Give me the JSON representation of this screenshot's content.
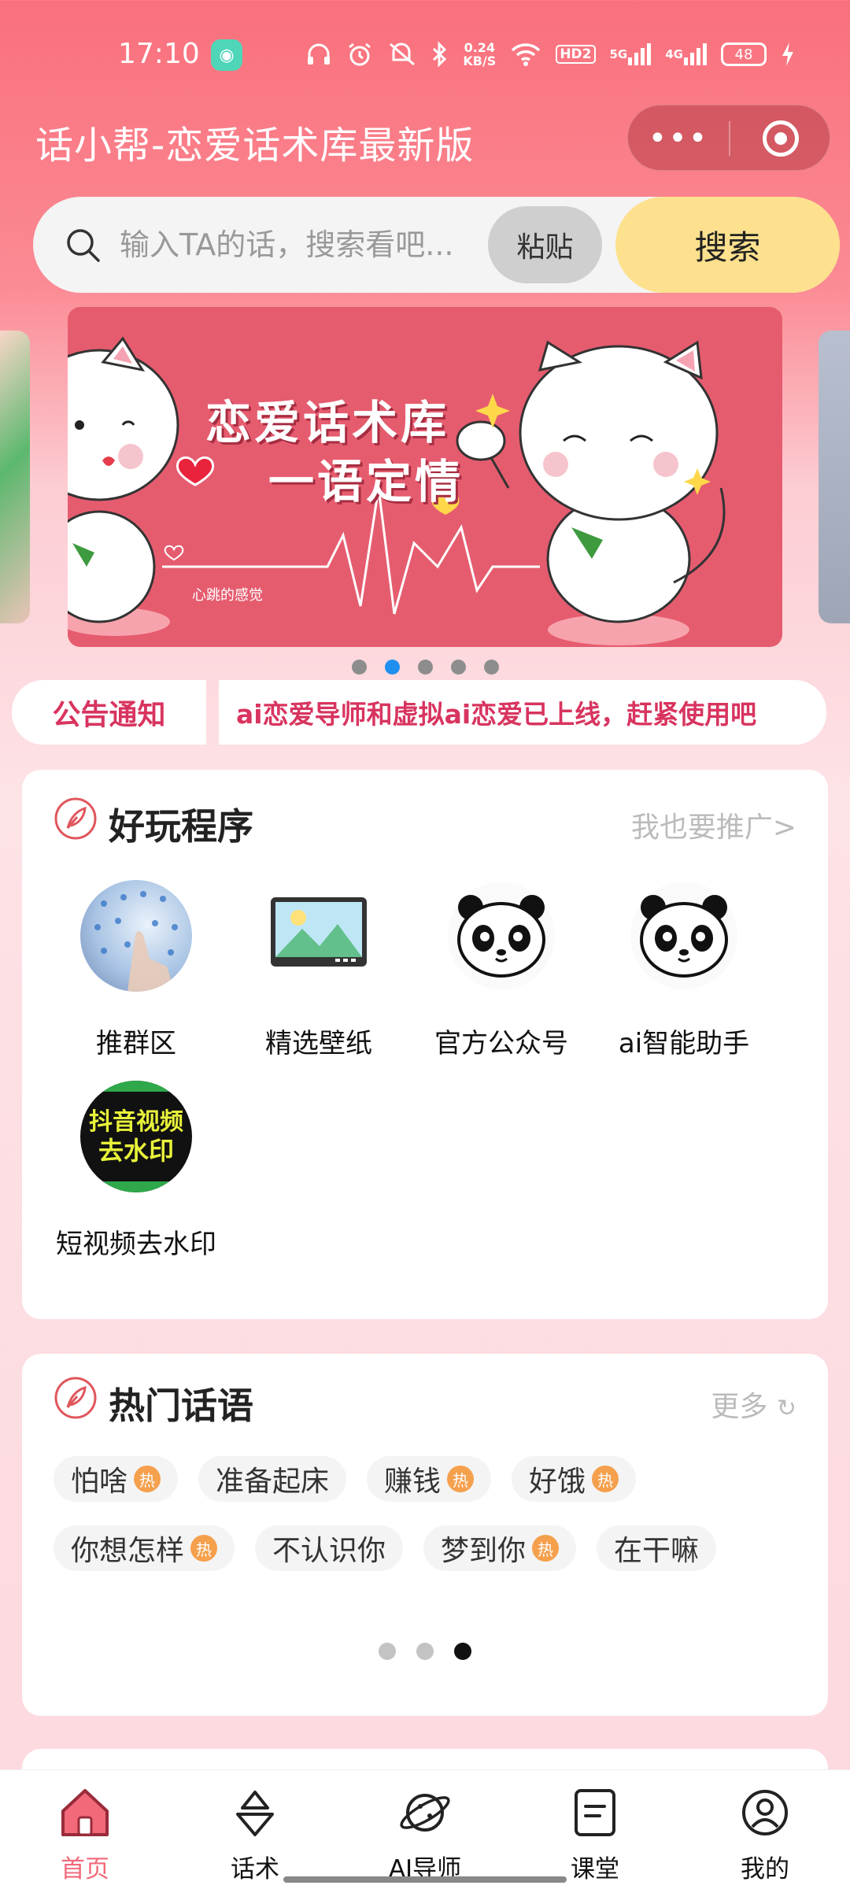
{
  "status_bar": {
    "time": "17:10",
    "net_speed_value": "0.24",
    "net_speed_unit": "KB/S",
    "hd_label": "HD2",
    "sig1_label": "5G",
    "sig2_label": "4G",
    "battery": "48",
    "icons": [
      "headphone-icon",
      "alarm-icon",
      "mute-icon",
      "bluetooth-icon",
      "wifi-icon",
      "signal-icon",
      "battery-icon",
      "charging-icon"
    ]
  },
  "header": {
    "title": "话小帮-恋爱话术库最新版",
    "more_label": "•••"
  },
  "search": {
    "placeholder": "输入TA的话，搜索看吧...",
    "paste_label": "粘贴",
    "search_label": "搜索"
  },
  "banner": {
    "line1": "恋爱话术库",
    "line2": "一语定情",
    "caption": "心跳的感觉",
    "dot_count": 5,
    "active_dot": 1
  },
  "notice": {
    "label": "公告通知",
    "text": "ai恋爱导师和虚拟ai恋爱已上线，赶紧使用吧"
  },
  "programs": {
    "title": "好玩程序",
    "link": "我也要推广>",
    "items": [
      {
        "label": "推群区",
        "icon": "group-icon"
      },
      {
        "label": "精选壁纸",
        "icon": "wallpaper-icon"
      },
      {
        "label": "官方公众号",
        "icon": "panda-icon"
      },
      {
        "label": "ai智能助手",
        "icon": "panda-icon"
      },
      {
        "label": "短视频去水印",
        "icon": "watermark-icon",
        "icon_text_1": "抖音视频",
        "icon_text_2": "去水印"
      }
    ]
  },
  "hot_phrases": {
    "title": "热门话语",
    "more": "更多",
    "refresh_glyph": "↻",
    "hot_badge": "热",
    "rows": [
      [
        {
          "text": "怕啥",
          "hot": true
        },
        {
          "text": "准备起床",
          "hot": false
        },
        {
          "text": "赚钱",
          "hot": true
        },
        {
          "text": "好饿",
          "hot": true
        }
      ],
      [
        {
          "text": "你想怎样",
          "hot": true
        },
        {
          "text": "不认识你",
          "hot": false
        },
        {
          "text": "梦到你",
          "hot": true
        },
        {
          "text": "在干嘛",
          "hot": false
        }
      ]
    ],
    "page_count": 3,
    "active_page": 2
  },
  "tab_bar": {
    "items": [
      {
        "label": "首页",
        "icon": "home-icon",
        "active": true
      },
      {
        "label": "话术",
        "icon": "speech-icon",
        "active": false
      },
      {
        "label": "AI导师",
        "icon": "planet-icon",
        "active": false
      },
      {
        "label": "课堂",
        "icon": "classroom-icon",
        "active": false
      },
      {
        "label": "我的",
        "icon": "profile-icon",
        "active": false
      }
    ]
  },
  "colors": {
    "accent": "#f2697a",
    "search_button": "#fde18e",
    "notice_text": "#d8345f",
    "hot_badge": "#f5a04d"
  }
}
